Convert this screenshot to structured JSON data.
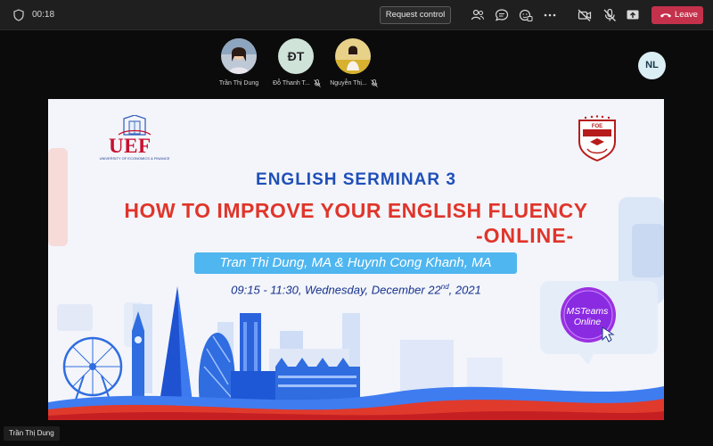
{
  "topbar": {
    "timer": "00:18",
    "request_control": "Request control",
    "leave": "Leave",
    "icons": [
      "shield-icon",
      "people-icon",
      "chat-icon",
      "reactions-icon",
      "more-icon",
      "camera-off-icon",
      "mic-off-icon",
      "share-icon",
      "phone-icon"
    ]
  },
  "participants": [
    {
      "name": "Trần Thị Dung",
      "initials": ""
    },
    {
      "name": "Đỗ Thanh T...",
      "initials": "ĐT"
    },
    {
      "name": "Nguyễn Thị...",
      "initials": ""
    }
  ],
  "self_avatar": "NL",
  "presenter": "Trần Thị Dung",
  "slide": {
    "logo_left": "UEF",
    "logo_left_sub": "UNIVERSITY OF ECONOMICS & FINANCE",
    "logo_right": "FOE",
    "heading1": "ENGLISH SERMINAR 3",
    "heading2": "HOW TO IMPROVE YOUR ENGLISH FLUENCY",
    "heading3": "-ONLINE-",
    "speakers": "Tran Thi Dung, MA & Huynh Cong Khanh, MA",
    "date_prefix": "09:15 - 11:30, Wednesday, December 22",
    "date_sup": "nd",
    "date_suffix": ", 2021",
    "bubble_line1": "MSTeams",
    "bubble_line2": "Online",
    "colors": {
      "blue": "#1f4fb8",
      "red": "#e0352b",
      "pill": "#4fb6f0",
      "purple": "#8a2be2"
    }
  }
}
